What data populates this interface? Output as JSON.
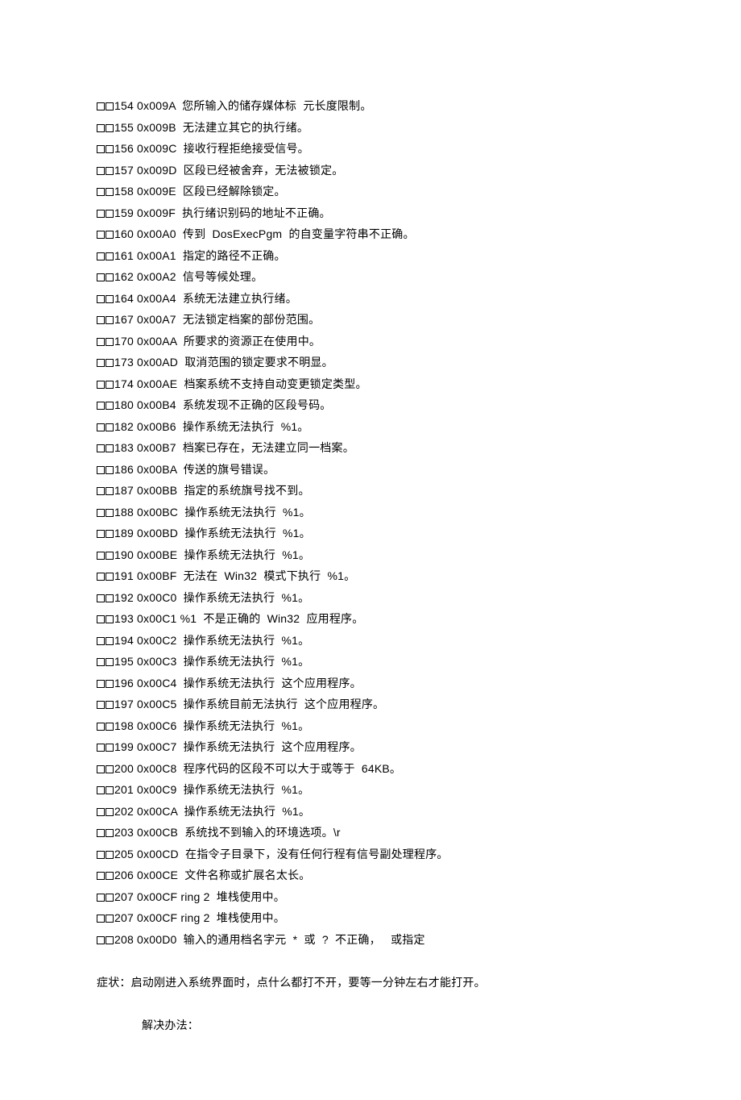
{
  "lines": [
    "154 0x009A  您所输入的储存媒体标  元长度限制。",
    "155 0x009B  无法建立其它的执行绪。",
    "156 0x009C  接收行程拒绝接受信号。",
    "157 0x009D  区段已经被舍弃，无法被锁定。",
    "158 0x009E  区段已经解除锁定。",
    "159 0x009F  执行绪识别码的地址不正确。",
    "160 0x00A0  传到  DosExecPgm  的自变量字符串不正确。",
    "161 0x00A1  指定的路径不正确。",
    "162 0x00A2  信号等候处理。",
    "164 0x00A4  系统无法建立执行绪。",
    "167 0x00A7  无法锁定档案的部份范围。",
    "170 0x00AA  所要求的资源正在使用中。",
    "173 0x00AD  取消范围的锁定要求不明显。",
    "174 0x00AE  档案系统不支持自动变更锁定类型。",
    "180 0x00B4  系统发现不正确的区段号码。",
    "182 0x00B6  操作系统无法执行  %1。",
    "183 0x00B7  档案已存在，无法建立同一档案。",
    "186 0x00BA  传送的旗号错误。",
    "187 0x00BB  指定的系统旗号找不到。",
    "188 0x00BC  操作系统无法执行  %1。",
    "189 0x00BD  操作系统无法执行  %1。",
    "190 0x00BE  操作系统无法执行  %1。",
    "191 0x00BF  无法在  Win32  模式下执行  %1。",
    "192 0x00C0  操作系统无法执行  %1。",
    "193 0x00C1 %1  不是正确的  Win32  应用程序。",
    "194 0x00C2  操作系统无法执行  %1。",
    "195 0x00C3  操作系统无法执行  %1。",
    "196 0x00C4  操作系统无法执行  这个应用程序。",
    "197 0x00C5  操作系统目前无法执行  这个应用程序。",
    "198 0x00C6  操作系统无法执行  %1。",
    "199 0x00C7  操作系统无法执行  这个应用程序。",
    "200 0x00C8  程序代码的区段不可以大于或等于  64KB。",
    "201 0x00C9  操作系统无法执行  %1。",
    "202 0x00CA  操作系统无法执行  %1。",
    "203 0x00CB  系统找不到输入的环境选项。\\r",
    "205 0x00CD  在指令子目录下，没有任何行程有信号副处理程序。",
    "206 0x00CE  文件名称或扩展名太长。",
    "207 0x00CF ring 2  堆栈使用中。",
    "207 0x00CF ring 2  堆栈使用中。",
    "208 0x00D0  输入的通用档名字元  *  或  ?  不正确，   或指定"
  ],
  "symptom": "症状：启动刚进入系统界面时，点什么都打不开，要等一分钟左右才能打开。",
  "solution": "解决办法："
}
